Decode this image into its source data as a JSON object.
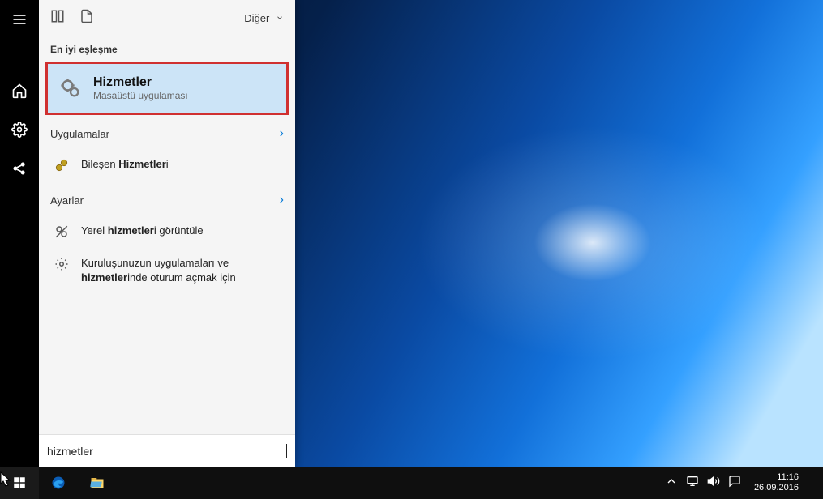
{
  "header": {
    "more_label": "Diğer"
  },
  "best_match": {
    "section_label": "En iyi eşleşme",
    "title": "Hizmetler",
    "subtitle": "Masaüstü uygulaması"
  },
  "categories": {
    "apps": {
      "label": "Uygulamalar",
      "items": [
        {
          "prefix": "Bileşen ",
          "bold": "Hizmetler",
          "suffix": "i"
        }
      ]
    },
    "settings": {
      "label": "Ayarlar",
      "items": [
        {
          "prefix": "Yerel ",
          "bold": "hizmetler",
          "suffix": "i görüntüle"
        },
        {
          "prefix": "Kuruluşunuzun uygulamaları ve ",
          "bold": "hizmetler",
          "suffix": "inde oturum açmak için"
        }
      ]
    }
  },
  "search": {
    "value": "hizmetler"
  },
  "taskbar": {
    "time": "11:16",
    "date": "26.09.2016"
  }
}
